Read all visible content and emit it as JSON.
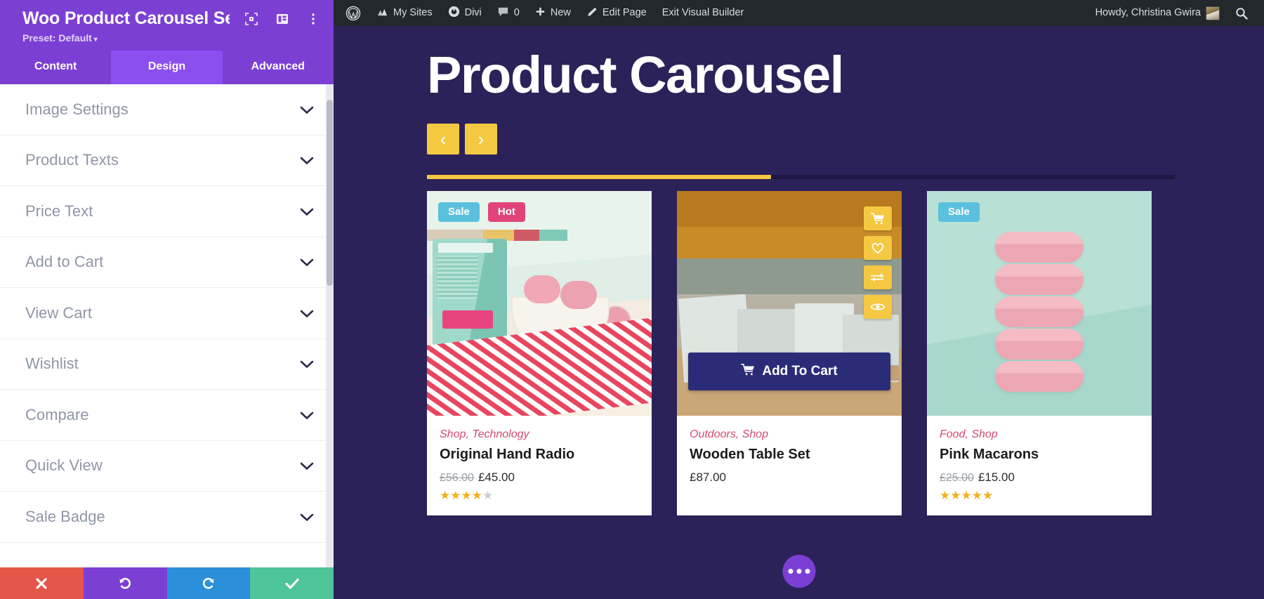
{
  "settings_panel": {
    "title": "Woo Product Carousel Setti...",
    "preset_label": "Preset: Default",
    "header_icons": [
      "focus-target-icon",
      "layout-panel-icon",
      "more-vertical-icon"
    ],
    "tabs": [
      {
        "label": "Content",
        "active": false
      },
      {
        "label": "Design",
        "active": true
      },
      {
        "label": "Advanced",
        "active": false
      }
    ],
    "sections": [
      {
        "label": "Image Settings"
      },
      {
        "label": "Product Texts"
      },
      {
        "label": "Price Text"
      },
      {
        "label": "Add to Cart"
      },
      {
        "label": "View Cart"
      },
      {
        "label": "Wishlist"
      },
      {
        "label": "Compare"
      },
      {
        "label": "Quick View"
      },
      {
        "label": "Sale Badge"
      }
    ],
    "footer_buttons": [
      {
        "name": "cancel",
        "icon": "close-icon",
        "color": "#e4564a"
      },
      {
        "name": "undo",
        "icon": "undo-icon",
        "color": "#7b3fd4"
      },
      {
        "name": "redo",
        "icon": "redo-icon",
        "color": "#2b90d9"
      },
      {
        "name": "save",
        "icon": "check-icon",
        "color": "#4ec49a"
      }
    ]
  },
  "admin_bar": {
    "logo": "wordpress-logo-icon",
    "items": [
      {
        "label": "My Sites",
        "icon": "sites-icon"
      },
      {
        "label": "Divi",
        "icon": "divi-icon"
      },
      {
        "label": "0",
        "icon": "comment-icon"
      },
      {
        "label": "New",
        "icon": "plus-icon"
      },
      {
        "label": "Edit Page",
        "icon": "pencil-icon"
      },
      {
        "label": "Exit Visual Builder",
        "icon": ""
      }
    ],
    "greeting": "Howdy, Christina Gwira",
    "search_icon": "search-icon"
  },
  "canvas": {
    "page_title": "Product Carousel",
    "prev_label": "‹",
    "next_label": "›",
    "progress_percent": 46,
    "more_options_icon": "ellipsis-icon",
    "colors": {
      "background": "#2b2259",
      "accent_yellow": "#f5c842",
      "purple": "#7b3fd4",
      "cart_button": "#2b2c78",
      "category_pink": "#d4486f",
      "sale_badge": "#5bc0de",
      "hot_badge": "#e0447a"
    },
    "products": [
      {
        "badges": [
          {
            "label": "Sale",
            "color": "#5bc0de"
          },
          {
            "label": "Hot",
            "color": "#e0447a"
          }
        ],
        "categories": "Shop, Technology",
        "name": "Original Hand Radio",
        "old_price": "£56.00",
        "price": "£45.00",
        "rating": 4,
        "max_rating": 5,
        "show_rating": true,
        "hovered": false
      },
      {
        "badges": [],
        "categories": "Outdoors, Shop",
        "name": "Wooden Table Set",
        "old_price": "",
        "price": "£87.00",
        "rating": 0,
        "max_rating": 5,
        "show_rating": false,
        "hovered": true,
        "hover_icons": [
          "cart-icon",
          "heart-icon",
          "compare-icon",
          "eye-icon"
        ],
        "add_to_cart_label": "Add To Cart"
      },
      {
        "badges": [
          {
            "label": "Sale",
            "color": "#5bc0de"
          }
        ],
        "categories": "Food, Shop",
        "name": "Pink Macarons",
        "old_price": "£25.00",
        "price": "£15.00",
        "rating": 5,
        "max_rating": 5,
        "show_rating": true,
        "hovered": false
      }
    ]
  }
}
